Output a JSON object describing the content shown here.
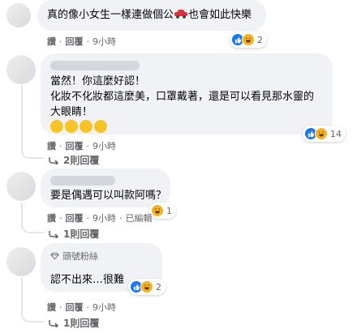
{
  "comments": [
    {
      "text": "真的像小女生一樣連做個公",
      "text_after": "也會如此快樂",
      "actions": [
        "讚",
        "回覆",
        "9小時"
      ],
      "reaction_count": "2"
    },
    {
      "text_lines": [
        "當然！你這麼好認！",
        "化妝不化妝都這麼美，口罩戴著，還是可以看見那水靈的",
        "大眼睛！"
      ],
      "actions": [
        "讚",
        "回覆",
        "9小時"
      ],
      "reaction_count": "14",
      "replies": "2則回覆"
    },
    {
      "text": "要是偶遇可以叫款阿嗎？",
      "actions": [
        "讚",
        "回覆",
        "9小時",
        "已編輯"
      ],
      "reaction_count": "1",
      "replies": "1則回覆"
    },
    {
      "badge": "頭號粉絲",
      "text": "認不出來…很難",
      "actions": [
        "讚",
        "回覆",
        "9小時"
      ],
      "reaction_count": "2",
      "replies": "1則回覆"
    }
  ],
  "separator": "·",
  "colors": {
    "like": "#1877f2",
    "haha": "#f7b125",
    "bubble": "#f0f2f5",
    "meta": "#65676b"
  }
}
